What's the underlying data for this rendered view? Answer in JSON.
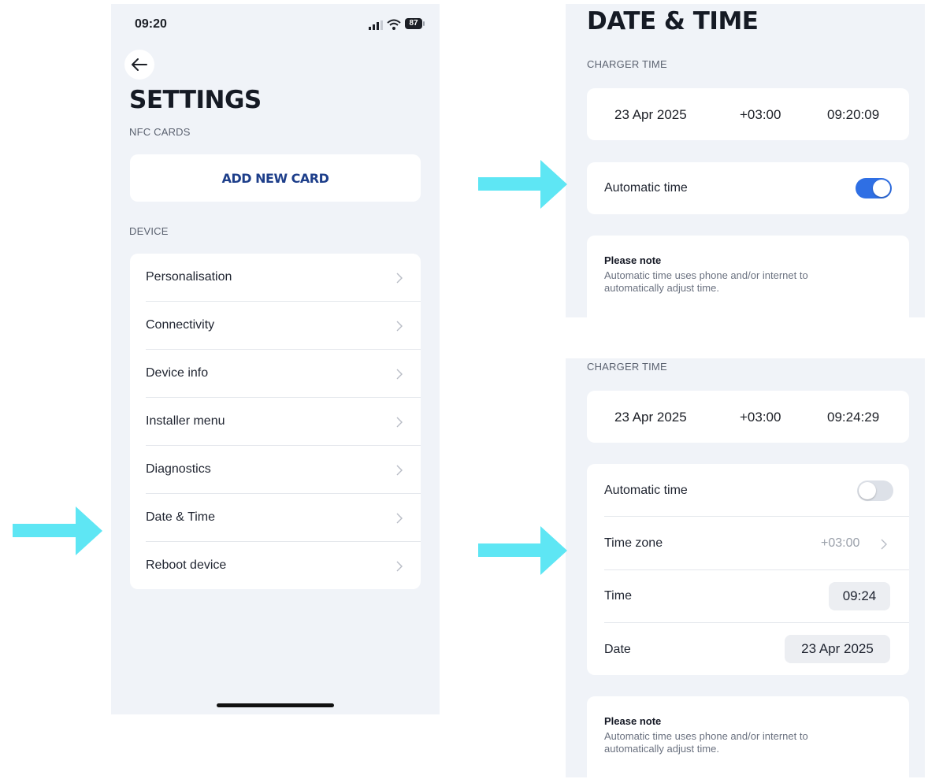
{
  "settings_screen": {
    "status_time": "09:20",
    "battery": "87",
    "title": "SETTINGS",
    "nfc_section": "NFC CARDS",
    "add_card_label": "ADD NEW CARD",
    "device_section": "DEVICE",
    "menu_items": [
      {
        "label": "Personalisation"
      },
      {
        "label": "Connectivity"
      },
      {
        "label": "Device info"
      },
      {
        "label": "Installer menu"
      },
      {
        "label": "Diagnostics"
      },
      {
        "label": "Date & Time"
      },
      {
        "label": "Reboot device"
      }
    ]
  },
  "datetime_auto": {
    "title": "DATE & TIME",
    "section": "CHARGER TIME",
    "date": "23 Apr 2025",
    "offset": "+03:00",
    "time": "09:20:09",
    "automatic_label": "Automatic time",
    "automatic_on": true,
    "note_title": "Please note",
    "note_text": "Automatic time uses phone and/or internet to automatically adjust time."
  },
  "datetime_manual": {
    "section": "CHARGER TIME",
    "date": "23 Apr 2025",
    "offset": "+03:00",
    "time": "09:24:29",
    "automatic_label": "Automatic time",
    "automatic_on": false,
    "timezone_label": "Time zone",
    "timezone_value": "+03:00",
    "time_label": "Time",
    "time_value": "09:24",
    "date_label": "Date",
    "date_value": "23 Apr 2025",
    "note_title": "Please note",
    "note_text": "Automatic time uses phone and/or internet to automatically adjust time."
  },
  "colors": {
    "accent": "#2f6fe4",
    "title_blue": "#1d3e8a",
    "arrow": "#5ee6f4",
    "panel_bg": "#f0f3f8"
  }
}
